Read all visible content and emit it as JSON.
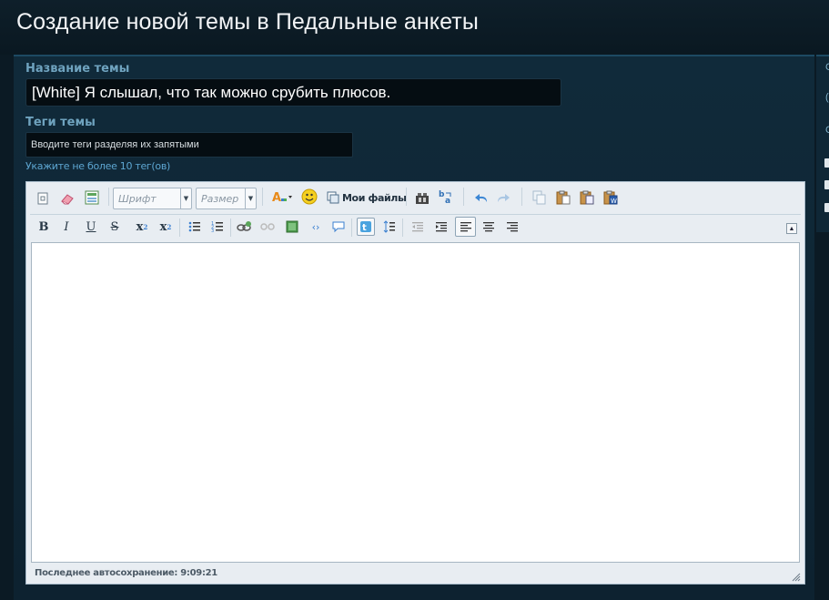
{
  "page": {
    "title": "Создание новой темы в Педальные анкеты"
  },
  "form": {
    "title_label": "Название темы",
    "title_value": "[White] Я слышал, что так можно срубить плюсов.",
    "tags_label": "Теги темы",
    "tags_placeholder": "Вводите теги разделяя их запятыми",
    "tags_hint": "Укажите не более 10 тег(ов)"
  },
  "editor": {
    "font_select": "Шрифт",
    "size_select": "Размер",
    "my_files": "Мои файлы",
    "autosave": "Последнее автосохранение: 9:09:21"
  },
  "side": {
    "chars": [
      "С",
      "(",
      "С"
    ]
  },
  "colors": {
    "background": "#0b1a24",
    "panel": "#0f2736",
    "label": "#6fa3bf",
    "link": "#5ea6d2"
  }
}
